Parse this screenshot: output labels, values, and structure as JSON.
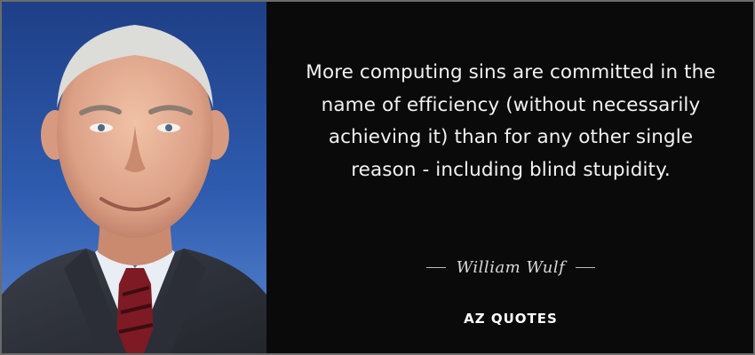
{
  "quote": {
    "text": "More computing sins are committed in the name of efficiency (without necessarily achieving it) than for any other single reason - including blind stupidity.",
    "author": "William Wulf"
  },
  "brand": {
    "logo_text": "AZ QUOTES"
  },
  "image": {
    "portrait": "portrait-photo"
  },
  "colors": {
    "background": "#0a0a0a",
    "text": "#f2f2f2",
    "author": "#d9d9d9",
    "portrait_backdrop": "#2f56a8"
  }
}
